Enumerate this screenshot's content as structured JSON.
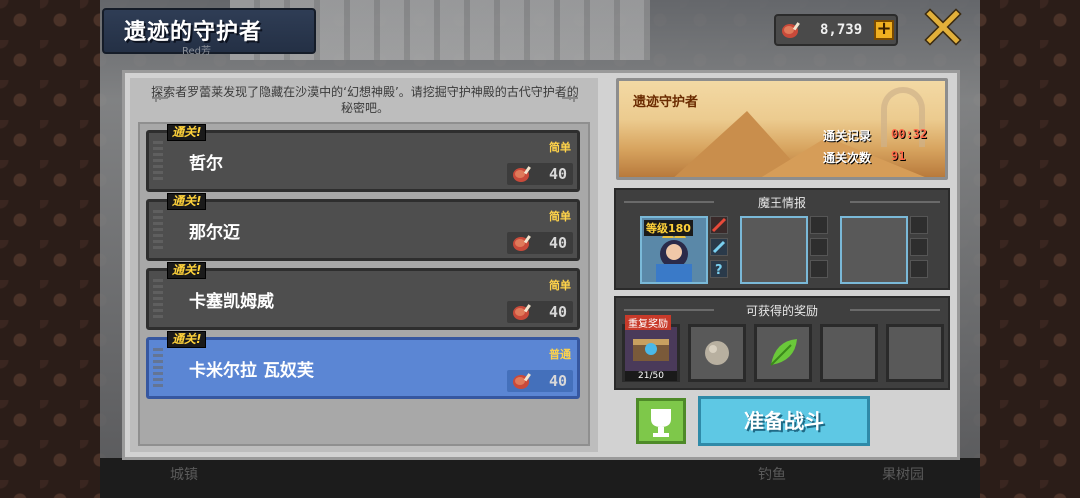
{
  "header": {
    "title": "遗迹的守护者",
    "subtitle": "Red芳",
    "currency_value": "8,739",
    "plus_label": "+"
  },
  "description": "探索者罗蕾莱发现了隐藏在沙漠中的‘幻想神殿’。请挖掘守护神殿的古代守护者的秘密吧。",
  "stages": [
    {
      "name": "哲尔",
      "difficulty": "简单",
      "cost": "40",
      "badge": "通关!"
    },
    {
      "name": "那尔迈",
      "difficulty": "简单",
      "cost": "40",
      "badge": "通关!"
    },
    {
      "name": "卡塞凯姆威",
      "difficulty": "简单",
      "cost": "40",
      "badge": "通关!"
    },
    {
      "name": "卡米尔拉 瓦奴芙",
      "difficulty": "普通",
      "cost": "40",
      "badge": "通关!"
    }
  ],
  "banner": {
    "title": "遗迹守护者",
    "record_label": "通关记录",
    "record_value": "00:32",
    "count_label": "通关次数",
    "count_value": "91"
  },
  "boss_info": {
    "title": "魔王情报",
    "level_label": "等级180"
  },
  "rewards": {
    "title": "可获得的奖励",
    "repeat_label": "重复奖励",
    "progress": "21/50"
  },
  "buttons": {
    "battle": "准备战斗"
  },
  "bottom": {
    "left_label": "城镇",
    "mid_label": "钓鱼",
    "right_label": "果树园"
  },
  "colors": {
    "active_stage": "#5b86d4",
    "badge_text": "#ffd23a",
    "battle_button": "#5ec8e4",
    "trophy_button": "#7ec84a"
  }
}
